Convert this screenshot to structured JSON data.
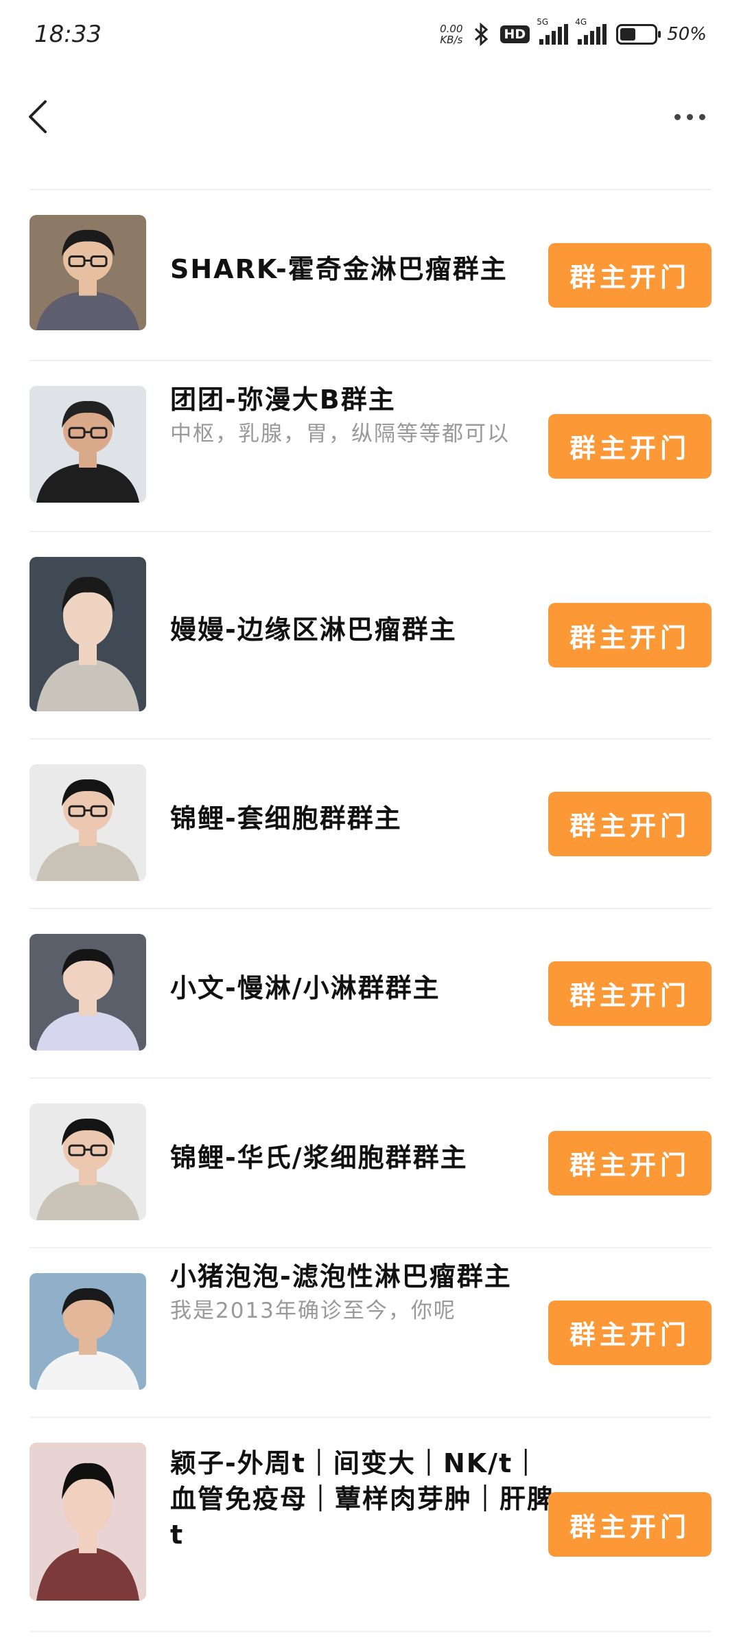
{
  "status_bar": {
    "time": "18:33",
    "net_speed_value": "0.00",
    "net_speed_unit": "KB/s",
    "hd_label": "HD",
    "sig1_tag": "5G",
    "sig2_tag": "4G",
    "battery": "50%",
    "battery_level": 0.5
  },
  "header": {
    "back_icon": "chevron-left-icon",
    "more_icon": "more-dots-icon"
  },
  "button_color": "#fd9836",
  "list": [
    {
      "name": "SHARK-霍奇金淋巴瘤群主",
      "sub": "",
      "button": "群主开门"
    },
    {
      "name": "团团-弥漫大B群主",
      "sub": "中枢，乳腺，胃，纵隔等等都可以",
      "button": "群主开门"
    },
    {
      "name": "嫚嫚-边缘区淋巴瘤群主",
      "sub": "",
      "button": "群主开门"
    },
    {
      "name": "锦鲤-套细胞群群主",
      "sub": "",
      "button": "群主开门"
    },
    {
      "name": "小文-慢淋/小淋群群主",
      "sub": "",
      "button": "群主开门"
    },
    {
      "name": "锦鲤-华氏/浆细胞群群主",
      "sub": "",
      "button": "群主开门"
    },
    {
      "name": "小猪泡泡-滤泡性淋巴瘤群主",
      "sub": "我是2013年确诊至今，你呢",
      "button": "群主开门"
    },
    {
      "name": "颖子-外周t｜间变大｜NK/t｜血管免疫母｜蕈样肉芽肿｜肝脾t",
      "sub": "",
      "button": "群主开门"
    }
  ]
}
